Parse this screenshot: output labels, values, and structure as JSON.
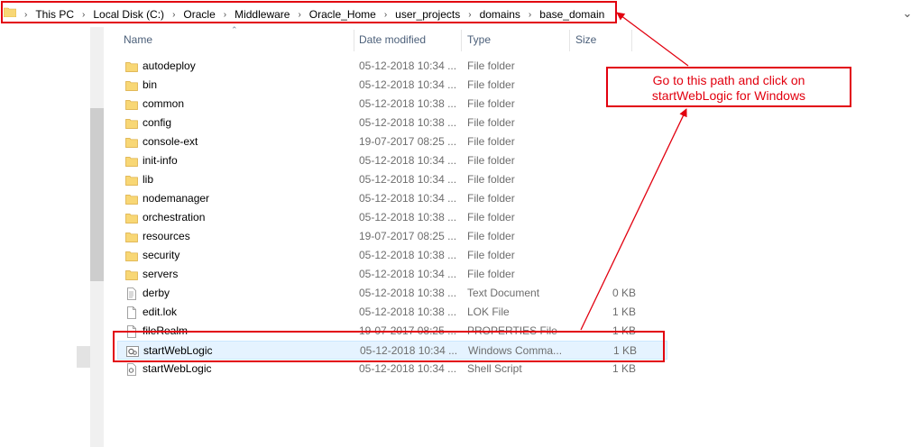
{
  "address_bar": {
    "crumbs": [
      "This PC",
      "Local Disk (C:)",
      "Oracle",
      "Middleware",
      "Oracle_Home",
      "user_projects",
      "domains",
      "base_domain"
    ]
  },
  "columns": {
    "name": "Name",
    "date": "Date modified",
    "type": "Type",
    "size": "Size"
  },
  "files": [
    {
      "name": "autodeploy",
      "date": "05-12-2018 10:34 ...",
      "type": "File folder",
      "size": "",
      "icon": "folder-icon"
    },
    {
      "name": "bin",
      "date": "05-12-2018 10:34 ...",
      "type": "File folder",
      "size": "",
      "icon": "folder-icon"
    },
    {
      "name": "common",
      "date": "05-12-2018 10:38 ...",
      "type": "File folder",
      "size": "",
      "icon": "folder-icon"
    },
    {
      "name": "config",
      "date": "05-12-2018 10:38 ...",
      "type": "File folder",
      "size": "",
      "icon": "folder-icon"
    },
    {
      "name": "console-ext",
      "date": "19-07-2017 08:25 ...",
      "type": "File folder",
      "size": "",
      "icon": "folder-icon"
    },
    {
      "name": "init-info",
      "date": "05-12-2018 10:34 ...",
      "type": "File folder",
      "size": "",
      "icon": "folder-icon"
    },
    {
      "name": "lib",
      "date": "05-12-2018 10:34 ...",
      "type": "File folder",
      "size": "",
      "icon": "folder-icon"
    },
    {
      "name": "nodemanager",
      "date": "05-12-2018 10:34 ...",
      "type": "File folder",
      "size": "",
      "icon": "folder-icon"
    },
    {
      "name": "orchestration",
      "date": "05-12-2018 10:38 ...",
      "type": "File folder",
      "size": "",
      "icon": "folder-icon"
    },
    {
      "name": "resources",
      "date": "19-07-2017 08:25 ...",
      "type": "File folder",
      "size": "",
      "icon": "folder-icon"
    },
    {
      "name": "security",
      "date": "05-12-2018 10:38 ...",
      "type": "File folder",
      "size": "",
      "icon": "folder-icon"
    },
    {
      "name": "servers",
      "date": "05-12-2018 10:34 ...",
      "type": "File folder",
      "size": "",
      "icon": "folder-icon"
    },
    {
      "name": "derby",
      "date": "05-12-2018 10:38 ...",
      "type": "Text Document",
      "size": "0 KB",
      "icon": "text-document-icon"
    },
    {
      "name": "edit.lok",
      "date": "05-12-2018 10:38 ...",
      "type": "LOK File",
      "size": "1 KB",
      "icon": "file-icon"
    },
    {
      "name": "fileRealm",
      "date": "19-07-2017 08:25 ...",
      "type": "PROPERTIES File",
      "size": "1 KB",
      "icon": "file-icon"
    },
    {
      "name": "startWebLogic",
      "date": "05-12-2018 10:34 ...",
      "type": "Windows Comma...",
      "size": "1 KB",
      "icon": "batch-file-icon",
      "selected": true
    },
    {
      "name": "startWebLogic",
      "date": "05-12-2018 10:34 ...",
      "type": "Shell Script",
      "size": "1 KB",
      "icon": "script-file-icon"
    }
  ],
  "callout": {
    "line1": "Go to this path and click on",
    "line2": "startWebLogic for Windows"
  },
  "colors": {
    "annotation": "#e2000f",
    "folder": "#f8d775",
    "header_text": "#4c607a",
    "selected_bg": "#e5f3ff"
  }
}
